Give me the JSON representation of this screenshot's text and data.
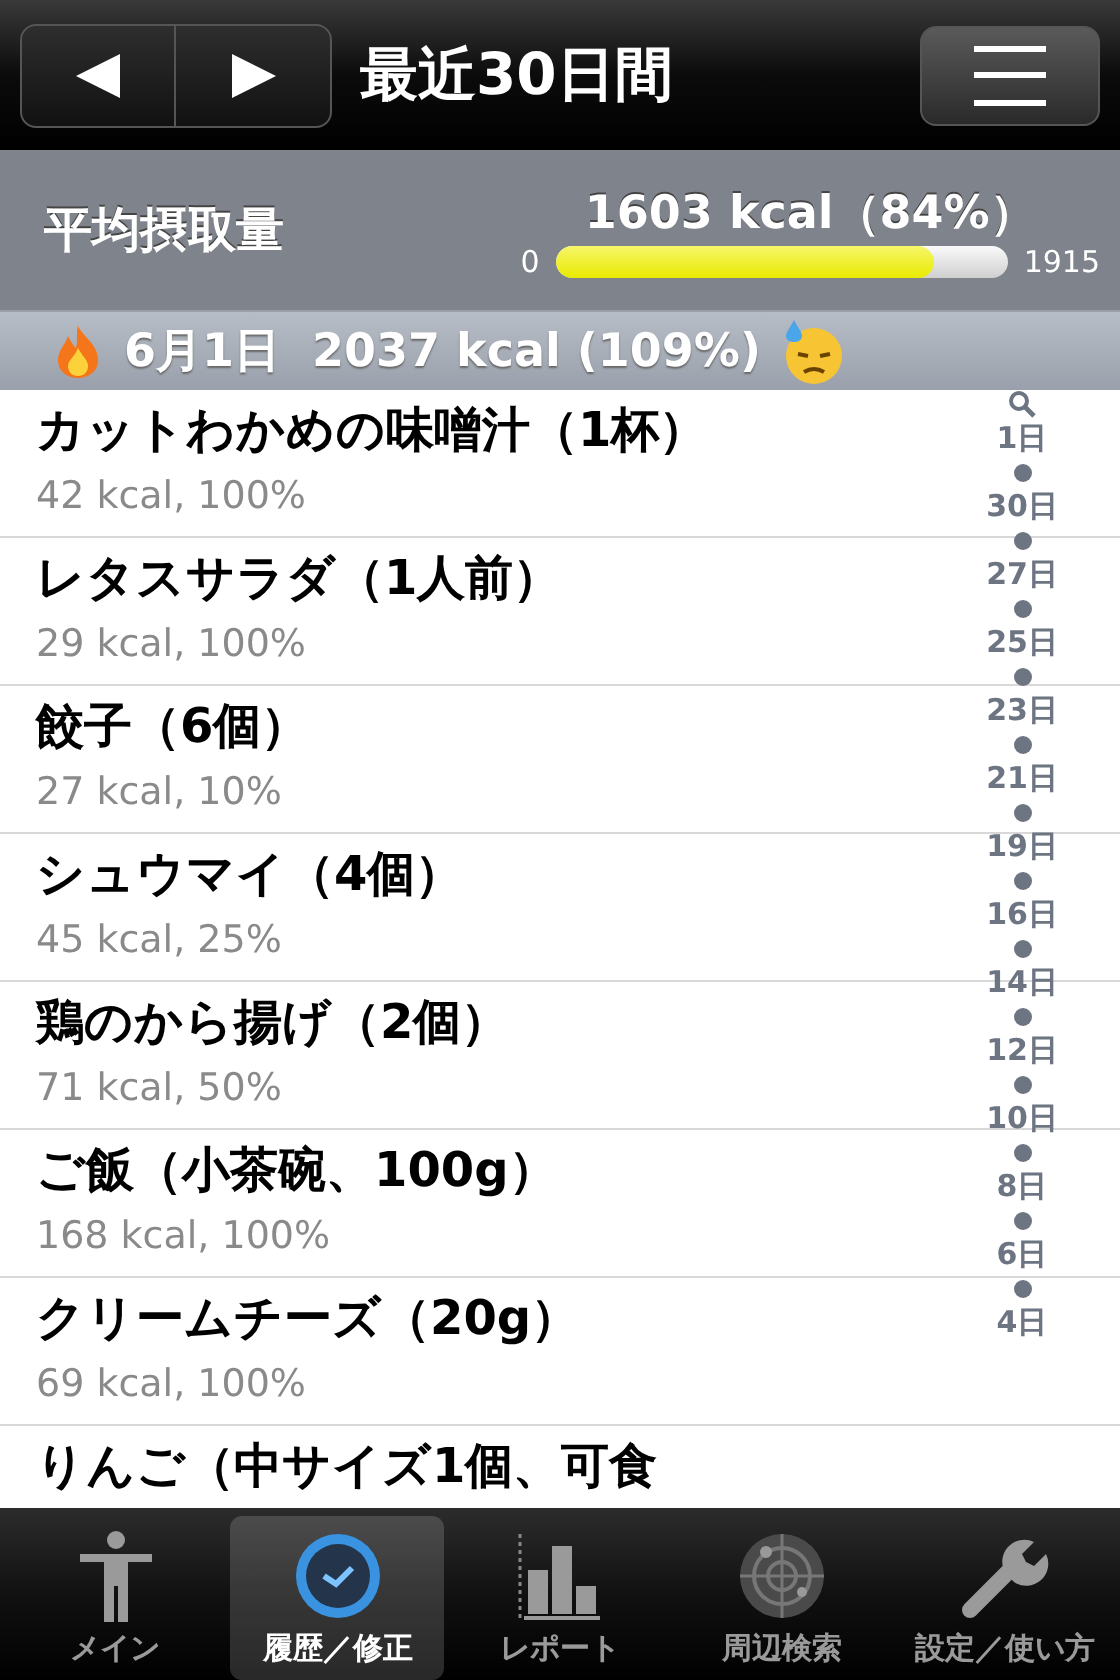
{
  "nav": {
    "title": "最近30日間"
  },
  "summary": {
    "label": "平均摂取量",
    "value": "1603 kcal（84%）",
    "min": "0",
    "max": "1915",
    "level": 0.837
  },
  "section": {
    "title": "6月1日  2037 kcal (109%)"
  },
  "items": [
    {
      "name": "カットわかめの味噌汁（1杯）",
      "detail": "42 kcal, 100%"
    },
    {
      "name": "レタスサラダ（1人前）",
      "detail": "29 kcal, 100%"
    },
    {
      "name": "餃子（6個）",
      "detail": "27 kcal, 10%"
    },
    {
      "name": "シュウマイ（4個）",
      "detail": "45 kcal, 25%"
    },
    {
      "name": "鶏のから揚げ（2個）",
      "detail": "71 kcal, 50%"
    },
    {
      "name": "ご飯（小茶碗、100g）",
      "detail": "168 kcal, 100%"
    },
    {
      "name": "クリームチーズ（20g）",
      "detail": "69 kcal, 100%"
    },
    {
      "name": "りんご（中サイズ1個、可食"
    }
  ],
  "index": [
    "1日",
    "30日",
    "27日",
    "25日",
    "23日",
    "21日",
    "19日",
    "16日",
    "14日",
    "12日",
    "10日",
    "8日",
    "6日",
    "4日"
  ],
  "tabs": [
    {
      "label": "メイン",
      "selected": false
    },
    {
      "label": "履歴／修正",
      "selected": true
    },
    {
      "label": "レポート",
      "selected": false
    },
    {
      "label": "周辺検索",
      "selected": false
    },
    {
      "label": "設定／使い方",
      "selected": false
    }
  ]
}
